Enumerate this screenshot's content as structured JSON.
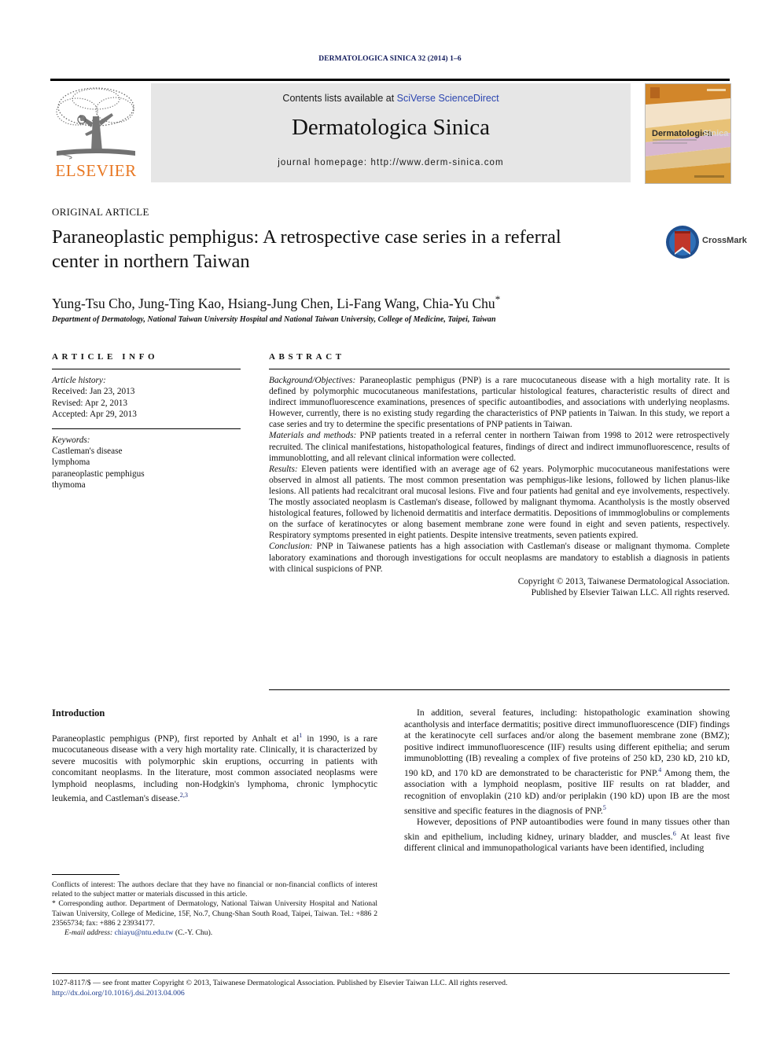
{
  "running_head": "DERMATOLOGICA SINICA 32 (2014) 1–6",
  "masthead": {
    "publisher_logo_label": "ELSEVIER",
    "contents_prefix": "Contents lists available at ",
    "contents_link": "SciVerse ScienceDirect",
    "journal_title": "Dermatologica Sinica",
    "journal_homepage": "journal homepage: http://www.derm-sinica.com",
    "cover_title_dark": "Dermatologica",
    "cover_title_light": "Sinica",
    "accent_orange": "#e87722",
    "link_blue": "#2b45b0",
    "band_gray": "#e6e6e6"
  },
  "article": {
    "kicker": "ORIGINAL ARTICLE",
    "title": "Paraneoplastic pemphigus: A retrospective case series in a referral center in northern Taiwan",
    "authors": "Yung-Tsu Cho, Jung-Ting Kao, Hsiang-Jung Chen, Li-Fang Wang, Chia-Yu Chu",
    "corresponding_marker": "*",
    "affiliation": "Department of Dermatology, National Taiwan University Hospital and National Taiwan University, College of Medicine, Taipei, Taiwan",
    "crossmark_label": "CrossMark"
  },
  "article_info": {
    "heading": "ARTICLE INFO",
    "history_label": "Article history:",
    "history": [
      "Received: Jan 23, 2013",
      "Revised: Apr 2, 2013",
      "Accepted: Apr 29, 2013"
    ],
    "keywords_label": "Keywords:",
    "keywords": [
      "Castleman's disease",
      "lymphoma",
      "paraneoplastic pemphigus",
      "thymoma"
    ]
  },
  "abstract": {
    "heading": "ABSTRACT",
    "sections": [
      {
        "label": "Background/Objectives:",
        "text": " Paraneoplastic pemphigus (PNP) is a rare mucocutaneous disease with a high mortality rate. It is defined by polymorphic mucocutaneous manifestations, particular histological features, characteristic results of direct and indirect immunofluorescence examinations, presences of specific autoantibodies, and associations with underlying neoplasms. However, currently, there is no existing study regarding the characteristics of PNP patients in Taiwan. In this study, we report a case series and try to determine the specific presentations of PNP patients in Taiwan."
      },
      {
        "label": "Materials and methods:",
        "text": " PNP patients treated in a referral center in northern Taiwan from 1998 to 2012 were retrospectively recruited. The clinical manifestations, histopathological features, findings of direct and indirect immunofluorescence, results of immunoblotting, and all relevant clinical information were collected."
      },
      {
        "label": "Results:",
        "text": " Eleven patients were identified with an average age of 62 years. Polymorphic mucocutaneous manifestations were observed in almost all patients. The most common presentation was pemphigus-like lesions, followed by lichen planus-like lesions. All patients had recalcitrant oral mucosal lesions. Five and four patients had genital and eye involvements, respectively. The mostly associated neoplasm is Castleman's disease, followed by malignant thymoma. Acantholysis is the mostly observed histological features, followed by lichenoid dermatitis and interface dermatitis. Depositions of immmoglobulins or complements on the surface of keratinocytes or along basement membrane zone were found in eight and seven patients, respectively. Respiratory symptoms presented in eight patients. Despite intensive treatments, seven patients expired."
      },
      {
        "label": "Conclusion:",
        "text": " PNP in Taiwanese patients has a high association with Castleman's disease or malignant thymoma. Complete laboratory examinations and thorough investigations for occult neoplasms are mandatory to establish a diagnosis in patients with clinical suspicions of PNP."
      }
    ],
    "copyright_line1": "Copyright © 2013, Taiwanese Dermatological Association.",
    "copyright_line2": "Published by Elsevier Taiwan LLC. All rights reserved."
  },
  "introduction": {
    "heading": "Introduction",
    "left_paragraph": "Paraneoplastic pemphigus (PNP), first reported by Anhalt et al",
    "left_ref1": "1",
    "left_paragraph_b": " in 1990, is a rare mucocutaneous disease with a very high mortality rate. Clinically, it is characterized by severe mucositis with polymorphic skin eruptions, occurring in patients with concomitant neoplasms. In the literature, most common associated neoplasms were lymphoid neoplasms, including non-Hodgkin's lymphoma, chronic lymphocytic leukemia, and Castleman's disease.",
    "left_ref2": "2,3",
    "right_p1_a": "In addition, several features, including: histopathologic examination showing acantholysis and interface dermatitis; positive direct immunofluorescence (DIF) findings at the keratinocyte cell surfaces and/or along the basement membrane zone (BMZ); positive indirect immunofluorescence (IIF) results using different epithelia; and serum immunoblotting (IB) revealing a complex of five proteins of 250 kD, 230 kD, 210 kD, 190 kD, and 170 kD are demonstrated to be characteristic for PNP.",
    "right_ref1": "4",
    "right_p1_b": " Among them, the association with a lymphoid neoplasm, positive IIF results on rat bladder, and recognition of envoplakin (210 kD) and/or periplakin (190 kD) upon IB are the most sensitive and specific features in the diagnosis of PNP.",
    "right_ref2": "5",
    "right_p2_a": "However, depositions of PNP autoantibodies were found in many tissues other than skin and epithelium, including kidney, urinary bladder, and muscles.",
    "right_ref3": "6",
    "right_p2_b": " At least five different clinical and immunopathological variants have been identified, including"
  },
  "footnotes": {
    "conflicts": "Conflicts of interest: The authors declare that they have no financial or non-financial conflicts of interest related to the subject matter or materials discussed in this article.",
    "corresponding_marker": "*",
    "corresponding": " Corresponding author. Department of Dermatology, National Taiwan University Hospital and National Taiwan University, College of Medicine, 15F, No.7, Chung-Shan South Road, Taipei, Taiwan. Tel.: +886 2 23565734; fax: +886 2 23934177.",
    "email_label": "E-mail address:",
    "email": "chiayu@ntu.edu.tw",
    "email_suffix": " (C.-Y. Chu)."
  },
  "page_footer": {
    "issn_line": "1027-8117/$ — see front matter Copyright © 2013, Taiwanese Dermatological Association. Published by Elsevier Taiwan LLC. All rights reserved.",
    "doi": "http://dx.doi.org/10.1016/j.dsi.2013.04.006"
  }
}
